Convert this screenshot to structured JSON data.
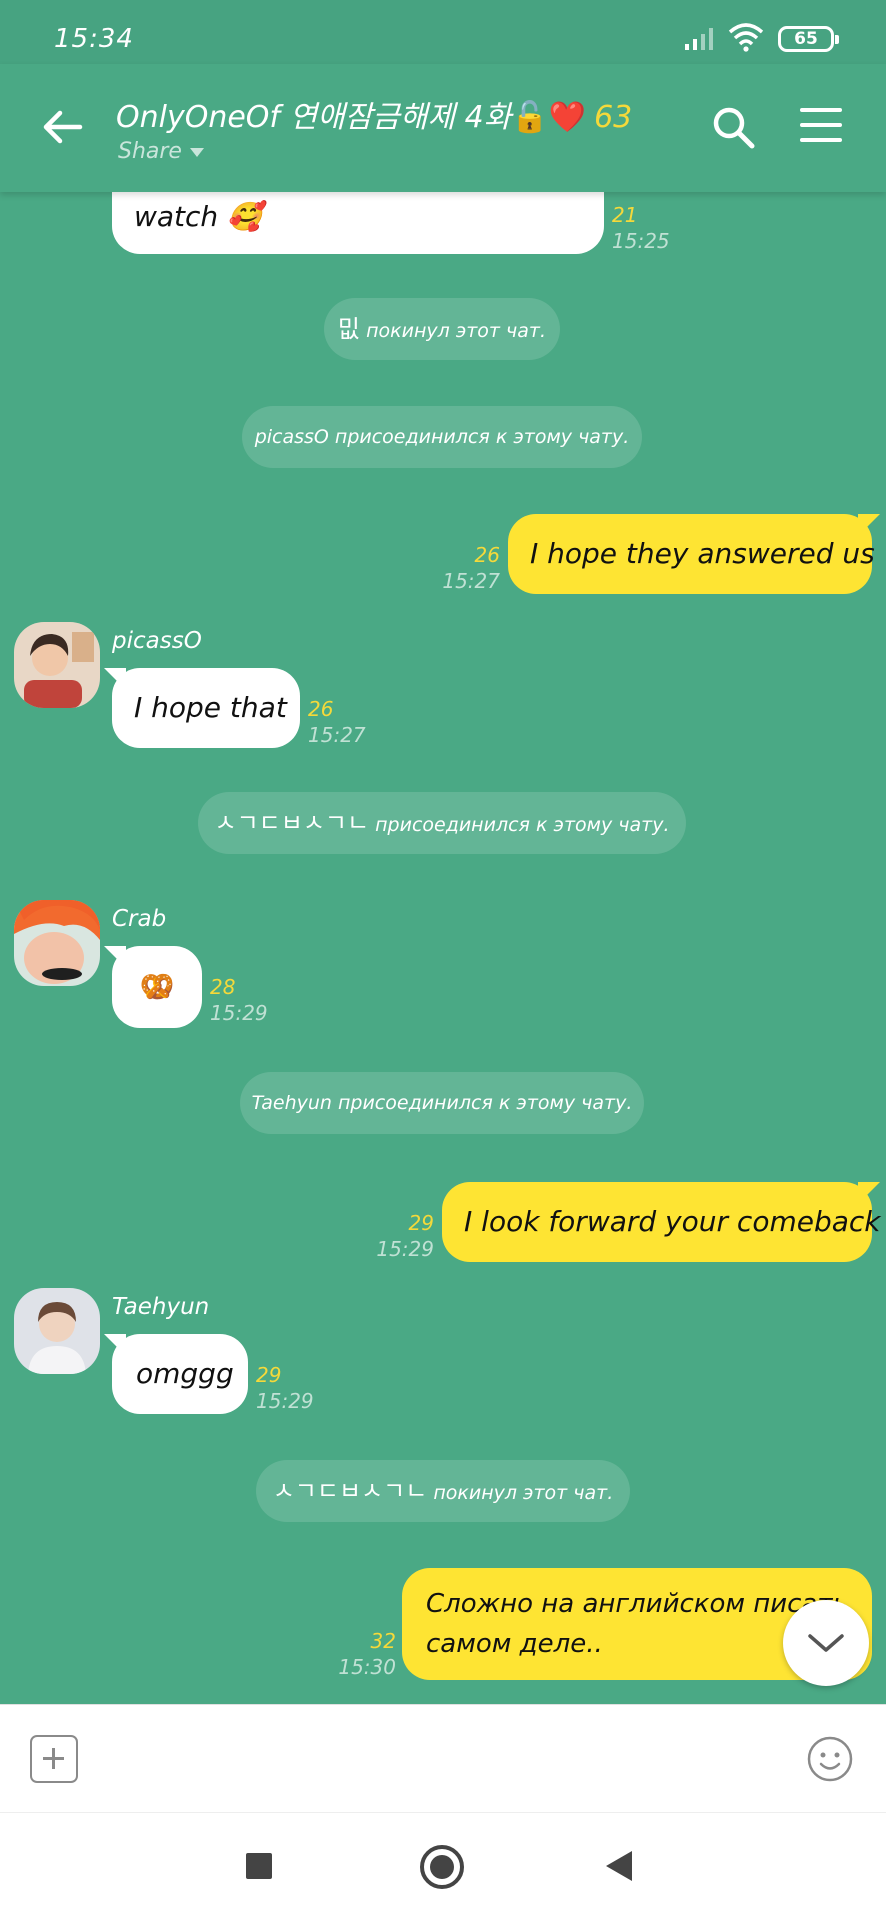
{
  "status_bar": {
    "time": "15:34",
    "battery": "65"
  },
  "header": {
    "title": "OnlyOneOf 연애잠금해제 4화",
    "title_emojis": "🔓❤️",
    "member_count": "63",
    "share_label": "Share"
  },
  "messages": {
    "m0": {
      "text": "watch 🥰",
      "count": "21",
      "time": "15:25"
    },
    "n1": {
      "name": "밊",
      "text": "покинул этот чат."
    },
    "n2": {
      "text": "picassO присоединился к этому чату."
    },
    "m3": {
      "text": "I hope they answered us",
      "count": "26",
      "time": "15:27"
    },
    "m4": {
      "sender": "picassO",
      "text": "I hope that",
      "count": "26",
      "time": "15:27"
    },
    "n5": {
      "name": "ㅅㄱㄷㅂㅅㄱㄴ",
      "text": "присоединился к этому чату."
    },
    "m6": {
      "sender": "Crab",
      "text": "🥨",
      "count": "28",
      "time": "15:29"
    },
    "n7": {
      "text": "Taehyun присоединился к этому чату."
    },
    "m8": {
      "text": "I look forward your comeback",
      "count": "29",
      "time": "15:29"
    },
    "m9": {
      "sender": "Taehyun",
      "text": "omggg",
      "count": "29",
      "time": "15:29"
    },
    "n10": {
      "name": "ㅅㄱㄷㅂㅅㄱㄴ",
      "text": "покинул этот чат."
    },
    "m11": {
      "line1": "Сложно на английском писать",
      "line2": "самом деле..",
      "count": "32",
      "time": "15:30"
    }
  },
  "icons": {
    "back": "back-arrow-icon",
    "search": "search-icon",
    "menu": "menu-icon",
    "scroll_down": "chevron-down-icon",
    "attach": "plus-icon",
    "emoji": "smiley-icon"
  },
  "colors": {
    "background": "#4aa985",
    "own_bubble": "#fee433",
    "other_bubble": "#ffffff",
    "read_count": "#f5d93a"
  }
}
